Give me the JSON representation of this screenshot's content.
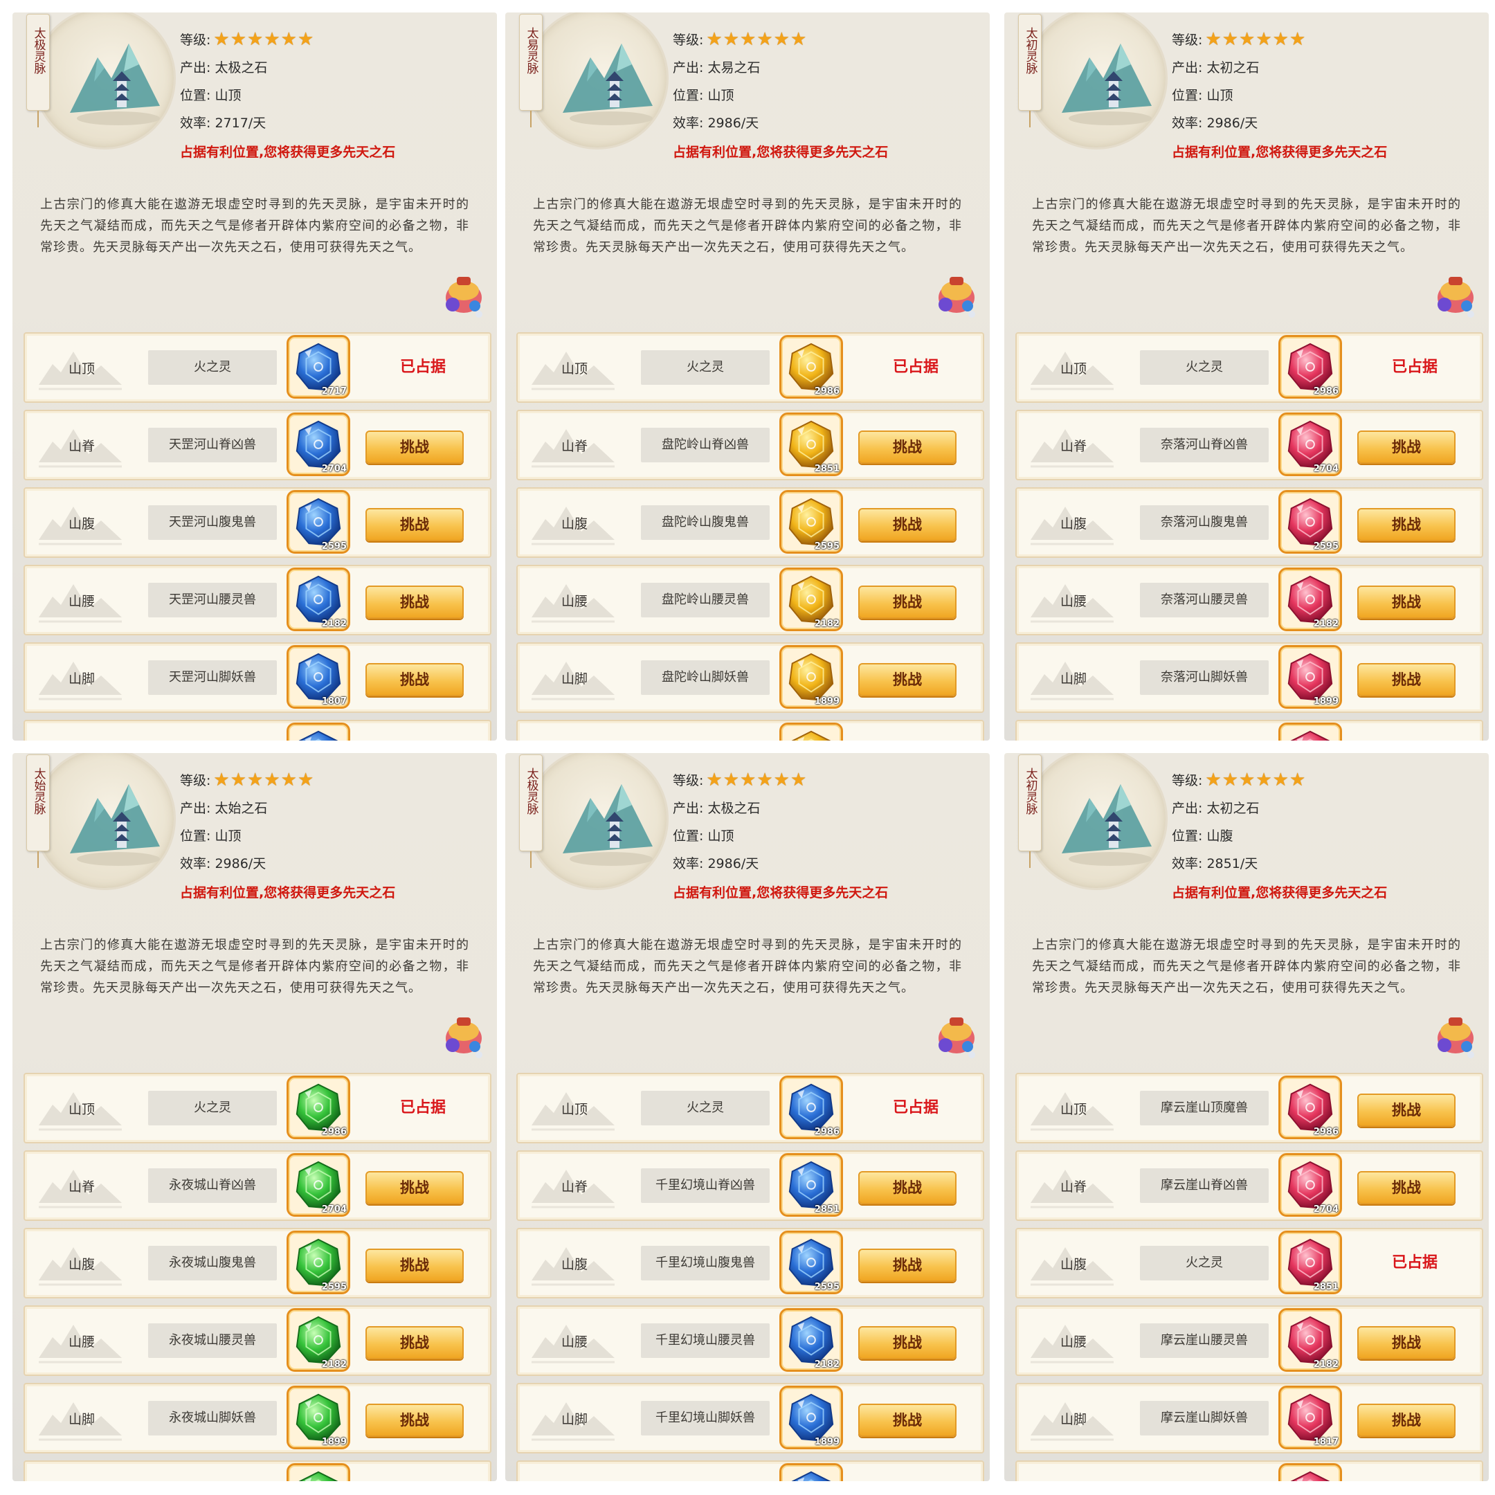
{
  "panels": [
    {
      "title": "太极灵脉",
      "level_label": "等级:",
      "stars": 6,
      "output_label": "产出:",
      "output": "太极之石",
      "location_label": "位置:",
      "location": "山顶",
      "efficiency_label": "效率:",
      "efficiency": "2717/天",
      "hint": "占据有利位置,您将获得更多先天之石",
      "description": "上古宗门的修真大能在遨游无垠虚空时寻到的先天灵脉，是宇宙未开时的先天之气凝结而成，而先天之气是修者开辟体内紫府空间的必备之物，非常珍贵。先天灵脉每天产出一次先天之石，使用可获得先天之气。",
      "gem_color": "blue",
      "rows": [
        {
          "loc": "山顶",
          "name": "火之灵",
          "count": "2717",
          "status": "已占据"
        },
        {
          "loc": "山脊",
          "name": "天罡河山脊凶兽",
          "count": "2704",
          "action": "挑战"
        },
        {
          "loc": "山腹",
          "name": "天罡河山腹鬼兽",
          "count": "2595",
          "action": "挑战"
        },
        {
          "loc": "山腰",
          "name": "天罡河山腰灵兽",
          "count": "2182",
          "action": "挑战"
        },
        {
          "loc": "山脚",
          "name": "天罡河山脚妖兽",
          "count": "1807",
          "action": "挑战"
        }
      ]
    },
    {
      "title": "太易灵脉",
      "level_label": "等级:",
      "stars": 6,
      "output_label": "产出:",
      "output": "太易之石",
      "location_label": "位置:",
      "location": "山顶",
      "efficiency_label": "效率:",
      "efficiency": "2986/天",
      "hint": "占据有利位置,您将获得更多先天之石",
      "description": "上古宗门的修真大能在遨游无垠虚空时寻到的先天灵脉，是宇宙未开时的先天之气凝结而成，而先天之气是修者开辟体内紫府空间的必备之物，非常珍贵。先天灵脉每天产出一次先天之石，使用可获得先天之气。",
      "gem_color": "gold",
      "rows": [
        {
          "loc": "山顶",
          "name": "火之灵",
          "count": "2986",
          "status": "已占据"
        },
        {
          "loc": "山脊",
          "name": "盘陀岭山脊凶兽",
          "count": "2851",
          "action": "挑战"
        },
        {
          "loc": "山腹",
          "name": "盘陀岭山腹鬼兽",
          "count": "2595",
          "action": "挑战"
        },
        {
          "loc": "山腰",
          "name": "盘陀岭山腰灵兽",
          "count": "2182",
          "action": "挑战"
        },
        {
          "loc": "山脚",
          "name": "盘陀岭山脚妖兽",
          "count": "1899",
          "action": "挑战"
        }
      ]
    },
    {
      "title": "太初灵脉",
      "level_label": "等级:",
      "stars": 6,
      "output_label": "产出:",
      "output": "太初之石",
      "location_label": "位置:",
      "location": "山顶",
      "efficiency_label": "效率:",
      "efficiency": "2986/天",
      "hint": "占据有利位置,您将获得更多先天之石",
      "description": "上古宗门的修真大能在遨游无垠虚空时寻到的先天灵脉，是宇宙未开时的先天之气凝结而成，而先天之气是修者开辟体内紫府空间的必备之物，非常珍贵。先天灵脉每天产出一次先天之石，使用可获得先天之气。",
      "gem_color": "red",
      "rows": [
        {
          "loc": "山顶",
          "name": "火之灵",
          "count": "2986",
          "status": "已占据"
        },
        {
          "loc": "山脊",
          "name": "奈落河山脊凶兽",
          "count": "2704",
          "action": "挑战"
        },
        {
          "loc": "山腹",
          "name": "奈落河山腹鬼兽",
          "count": "2595",
          "action": "挑战"
        },
        {
          "loc": "山腰",
          "name": "奈落河山腰灵兽",
          "count": "2182",
          "action": "挑战"
        },
        {
          "loc": "山脚",
          "name": "奈落河山脚妖兽",
          "count": "1899",
          "action": "挑战"
        }
      ]
    },
    {
      "title": "太始灵脉",
      "level_label": "等级:",
      "stars": 6,
      "output_label": "产出:",
      "output": "太始之石",
      "location_label": "位置:",
      "location": "山顶",
      "efficiency_label": "效率:",
      "efficiency": "2986/天",
      "hint": "占据有利位置,您将获得更多先天之石",
      "description": "上古宗门的修真大能在遨游无垠虚空时寻到的先天灵脉，是宇宙未开时的先天之气凝结而成，而先天之气是修者开辟体内紫府空间的必备之物，非常珍贵。先天灵脉每天产出一次先天之石，使用可获得先天之气。",
      "gem_color": "green",
      "rows": [
        {
          "loc": "山顶",
          "name": "火之灵",
          "count": "2986",
          "status": "已占据"
        },
        {
          "loc": "山脊",
          "name": "永夜城山脊凶兽",
          "count": "2704",
          "action": "挑战"
        },
        {
          "loc": "山腹",
          "name": "永夜城山腹鬼兽",
          "count": "2595",
          "action": "挑战"
        },
        {
          "loc": "山腰",
          "name": "永夜城山腰灵兽",
          "count": "2182",
          "action": "挑战"
        },
        {
          "loc": "山脚",
          "name": "永夜城山脚妖兽",
          "count": "1899",
          "action": "挑战"
        }
      ]
    },
    {
      "title": "太极灵脉",
      "level_label": "等级:",
      "stars": 6,
      "output_label": "产出:",
      "output": "太极之石",
      "location_label": "位置:",
      "location": "山顶",
      "efficiency_label": "效率:",
      "efficiency": "2986/天",
      "hint": "占据有利位置,您将获得更多先天之石",
      "description": "上古宗门的修真大能在遨游无垠虚空时寻到的先天灵脉，是宇宙未开时的先天之气凝结而成，而先天之气是修者开辟体内紫府空间的必备之物，非常珍贵。先天灵脉每天产出一次先天之石，使用可获得先天之气。",
      "gem_color": "blue",
      "rows": [
        {
          "loc": "山顶",
          "name": "火之灵",
          "count": "2986",
          "status": "已占据"
        },
        {
          "loc": "山脊",
          "name": "千里幻境山脊凶兽",
          "count": "2851",
          "action": "挑战"
        },
        {
          "loc": "山腹",
          "name": "千里幻境山腹鬼兽",
          "count": "2595",
          "action": "挑战"
        },
        {
          "loc": "山腰",
          "name": "千里幻境山腰灵兽",
          "count": "2182",
          "action": "挑战"
        },
        {
          "loc": "山脚",
          "name": "千里幻境山脚妖兽",
          "count": "1899",
          "action": "挑战"
        }
      ]
    },
    {
      "title": "太初灵脉",
      "level_label": "等级:",
      "stars": 6,
      "output_label": "产出:",
      "output": "太初之石",
      "location_label": "位置:",
      "location": "山腹",
      "efficiency_label": "效率:",
      "efficiency": "2851/天",
      "hint": "占据有利位置,您将获得更多先天之石",
      "description": "上古宗门的修真大能在遨游无垠虚空时寻到的先天灵脉，是宇宙未开时的先天之气凝结而成，而先天之气是修者开辟体内紫府空间的必备之物，非常珍贵。先天灵脉每天产出一次先天之石，使用可获得先天之气。",
      "gem_color": "red",
      "rows": [
        {
          "loc": "山顶",
          "name": "摩云崖山顶魔兽",
          "count": "2986",
          "action": "挑战"
        },
        {
          "loc": "山脊",
          "name": "摩云崖山脊凶兽",
          "count": "2704",
          "action": "挑战"
        },
        {
          "loc": "山腹",
          "name": "火之灵",
          "count": "2851",
          "status": "已占据"
        },
        {
          "loc": "山腰",
          "name": "摩云崖山腰灵兽",
          "count": "2182",
          "action": "挑战"
        },
        {
          "loc": "山脚",
          "name": "摩云崖山脚妖兽",
          "count": "1817",
          "action": "挑战"
        }
      ]
    }
  ],
  "colors": {
    "blue": [
      "#9fd4ff",
      "#2a6fd6",
      "#123a8a"
    ],
    "gold": [
      "#fff1a0",
      "#f1b418",
      "#a0620a"
    ],
    "red": [
      "#ffc2cf",
      "#e5365e",
      "#8c1030"
    ],
    "green": [
      "#c8ffb6",
      "#35c23a",
      "#136b1a"
    ]
  }
}
